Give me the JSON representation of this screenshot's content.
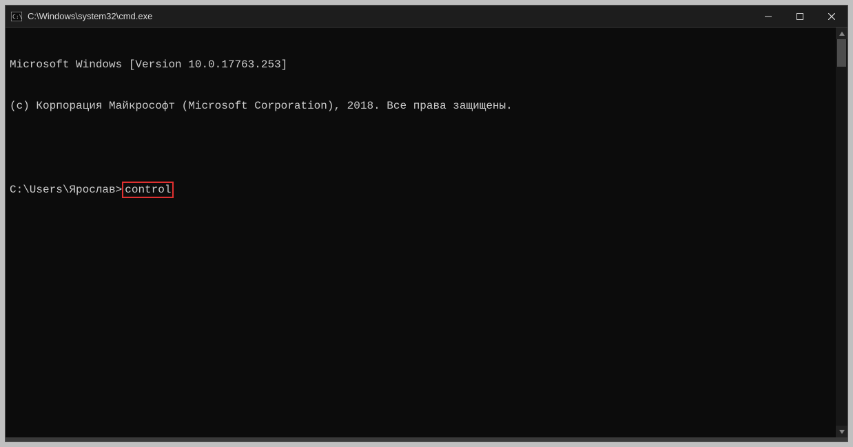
{
  "window": {
    "title": "C:\\Windows\\system32\\cmd.exe"
  },
  "terminal": {
    "banner_line1": "Microsoft Windows [Version 10.0.17763.253]",
    "banner_line2": "(c) Корпорация Майкрософт (Microsoft Corporation), 2018. Все права защищены.",
    "prompt": "C:\\Users\\Ярослав>",
    "command": "control"
  }
}
